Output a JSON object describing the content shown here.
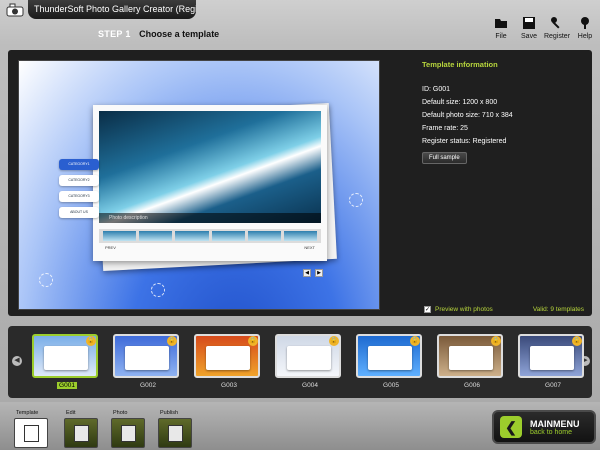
{
  "window": {
    "title": "ThunderSoft Photo Gallery Creator (Registered)"
  },
  "toolbar": {
    "items": [
      {
        "label": "File",
        "icon": "folder-icon"
      },
      {
        "label": "Save",
        "icon": "save-icon"
      },
      {
        "label": "Register",
        "icon": "key-icon"
      },
      {
        "label": "Help",
        "icon": "help-icon"
      }
    ]
  },
  "step": {
    "number": "STEP 1",
    "title": "Choose a template"
  },
  "preview": {
    "photo_caption": "Photo description",
    "categories": [
      "CATEGORY1",
      "CATEGORY2",
      "CATEGORY3",
      "ABOUT US"
    ],
    "nav_prev": "PREV",
    "nav_next": "NEXT"
  },
  "template_info": {
    "heading": "Template information",
    "id": "ID: G001",
    "default_size": "Default size: 1200 x 800",
    "default_photo_size": "Default photo size: 710 x 384",
    "frame_rate": "Frame rate: 25",
    "register_status": "Register status: Registered",
    "full_sample_label": "Full sample"
  },
  "preview_with_photos": {
    "label": "Preview with photos",
    "checked": true
  },
  "valid": "Valid: 9 templates",
  "templates": [
    {
      "id": "G001",
      "selected": true
    },
    {
      "id": "G002",
      "selected": false
    },
    {
      "id": "G003",
      "selected": false
    },
    {
      "id": "G004",
      "selected": false
    },
    {
      "id": "G005",
      "selected": false
    },
    {
      "id": "G006",
      "selected": false
    },
    {
      "id": "G007",
      "selected": false
    }
  ],
  "bottom_nav": {
    "items": [
      {
        "label": "Template",
        "active": true
      },
      {
        "label": "Edit",
        "active": false
      },
      {
        "label": "Photo",
        "active": false
      },
      {
        "label": "Publish",
        "active": false
      }
    ]
  },
  "main_menu": {
    "title": "MAINMENU",
    "subtitle": "back to home"
  },
  "colors": {
    "accent": "#9ccd2c",
    "info_heading": "#b7d53c",
    "panel": "#1f1f1f"
  }
}
